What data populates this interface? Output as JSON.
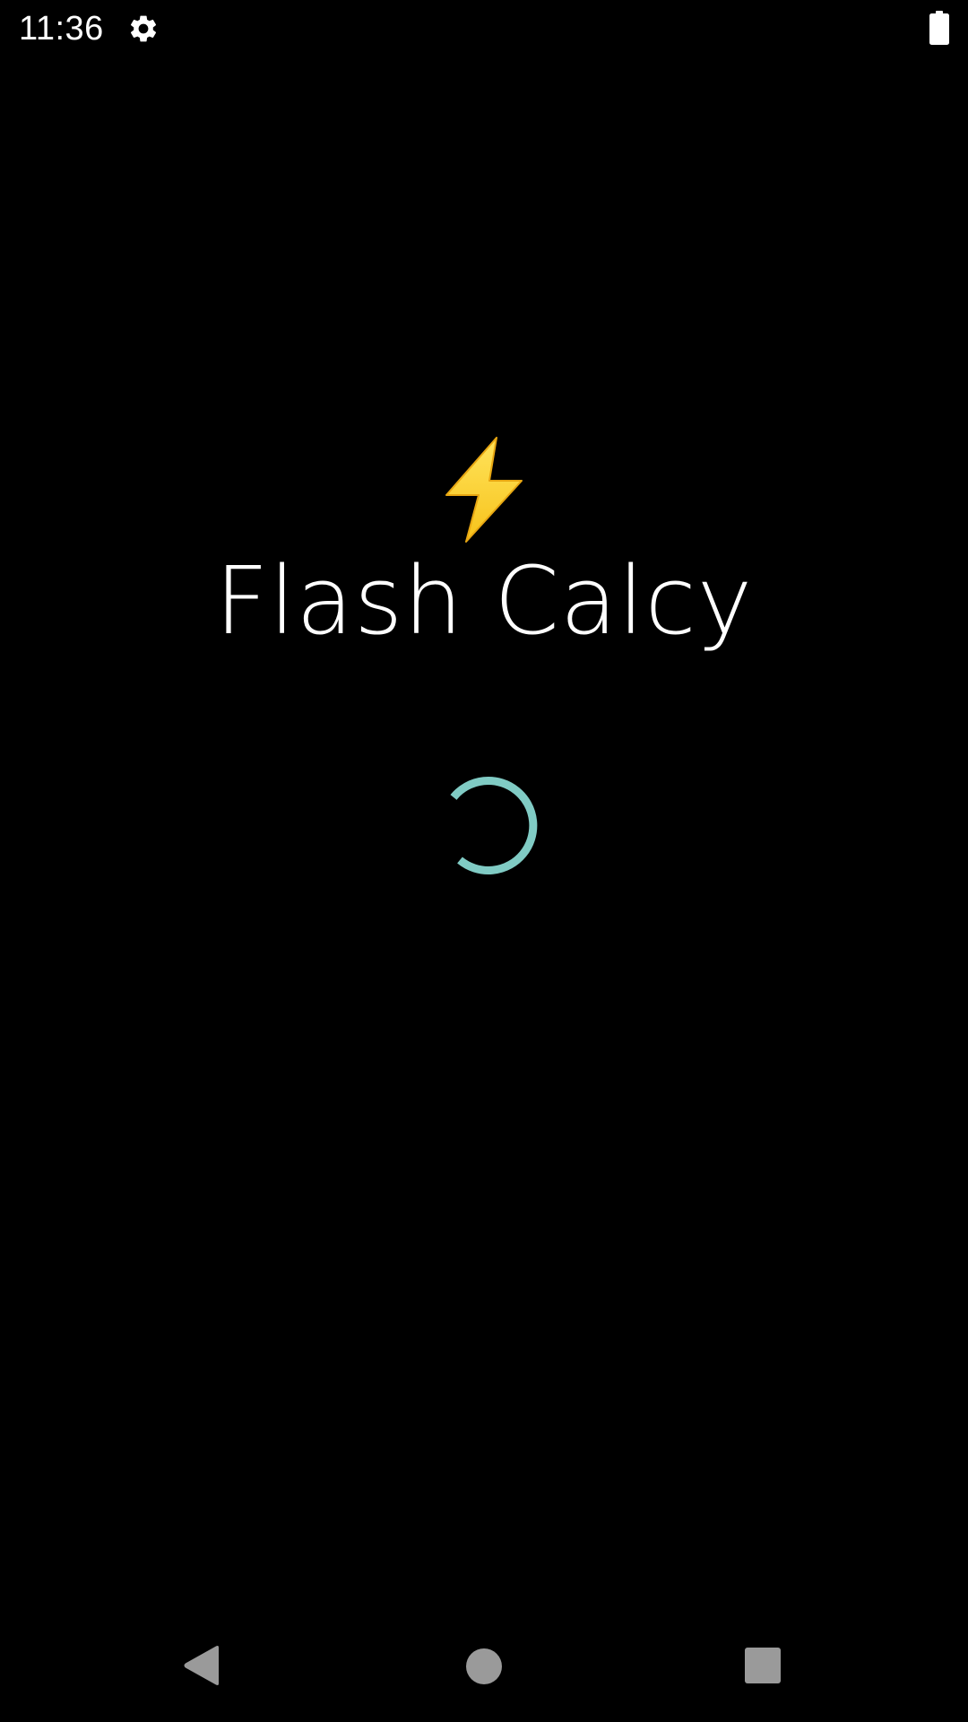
{
  "status_bar": {
    "time": "11:36",
    "icons": [
      "gear-icon",
      "battery-icon"
    ]
  },
  "splash": {
    "logo_icon": "lightning-bolt-icon",
    "app_name": "Flash Calcy",
    "loading_indicator": "loading-spinner"
  },
  "nav_bar": {
    "buttons": [
      "back-icon",
      "home-icon",
      "recents-icon"
    ]
  },
  "colors": {
    "background": "#000000",
    "text": "#ffffff",
    "spinner": "#80CBC4",
    "bolt": "#FFD93B",
    "nav_buttons": "#9a9a9a"
  }
}
